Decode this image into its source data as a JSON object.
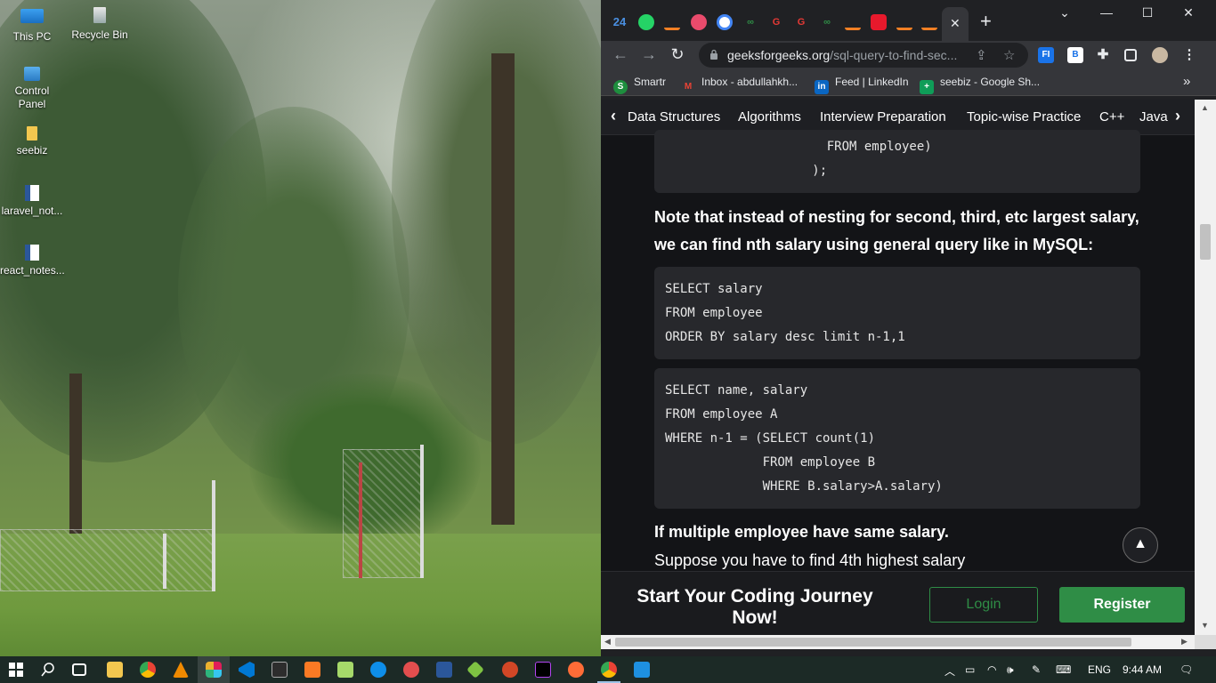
{
  "desktop": {
    "icons": [
      {
        "label": "This PC"
      },
      {
        "label": "Recycle Bin"
      },
      {
        "label": "Control Panel"
      },
      {
        "label": "seebiz"
      },
      {
        "label": "laravel_not..."
      },
      {
        "label": "react_notes..."
      }
    ]
  },
  "browser": {
    "tab_favicons": [
      "24",
      "whatsapp-icon",
      "stackoverflow-icon",
      "gmail-icon",
      "google-icon",
      "gfg-icon",
      "g-red-icon",
      "g-red-icon",
      "gfg-icon",
      "stackoverflow-icon",
      "opera-icon",
      "stackoverflow-icon",
      "stackoverflow-icon"
    ],
    "tab_first_label": "24",
    "active_tab_close": "✕",
    "new_tab": "+",
    "window_controls": {
      "minimize": "—",
      "maximize": "☐",
      "close": "✕",
      "tab_search": "⌄"
    },
    "nav": {
      "back": "←",
      "forward": "→",
      "reload": "↻"
    },
    "url_host": "geeksforgeeks.org",
    "url_path": "/sql-query-to-find-sec...",
    "extensions": [
      "FI",
      "B"
    ],
    "bookmarks": [
      {
        "label": "Smartr",
        "icon": "S",
        "color": "#1e8e3e"
      },
      {
        "label": "Inbox - abdullahkh...",
        "icon": "M",
        "color": "#ea4335"
      },
      {
        "label": "Feed | LinkedIn",
        "icon": "in",
        "color": "#0a66c2"
      },
      {
        "label": "seebiz - Google Sh...",
        "icon": "+",
        "color": "#0f9d58"
      }
    ],
    "bookmarks_more": "»"
  },
  "page": {
    "nav_items": [
      "Data Structures",
      "Algorithms",
      "Interview Preparation",
      "Topic-wise Practice",
      "C++",
      "Java"
    ],
    "nav_prev": "‹",
    "nav_next": "›",
    "code_top": [
      "    FROM employee)",
      "   );"
    ],
    "note_text": "Note that instead of nesting for second, third, etc largest salary, we can find nth salary using general query like in MySQL:",
    "code_block_1": [
      "SELECT salary",
      "FROM employee",
      "ORDER BY salary desc limit n-1,1"
    ],
    "code_block_2": [
      "SELECT name, salary",
      "FROM employee A",
      "WHERE n-1 = (SELECT count(1)",
      "             FROM employee B",
      "             WHERE B.salary>A.salary)"
    ],
    "heading_same_salary": "If multiple employee have same salary.",
    "suppose_text": "Suppose you have to find 4th highest salary",
    "scroll_top": "▲",
    "cta_title": "Start Your Coding Journey Now!",
    "login_label": "Login",
    "register_label": "Register",
    "brand_color": "#2f8d46"
  },
  "taskbar": {
    "language": "ENG",
    "time": "9:44 AM"
  }
}
